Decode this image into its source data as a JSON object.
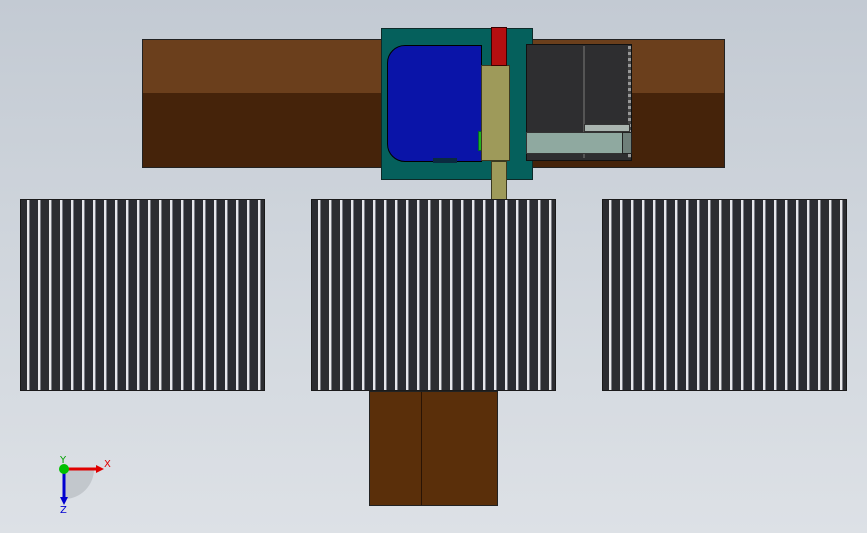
{
  "viewport": {
    "background": "#cfd5dc"
  },
  "colors": {
    "beam_top": "#6b3f1c",
    "beam_bottom": "#45230a",
    "housing": "#05605c",
    "drum": "#0a14a8",
    "olive": "#9e9a5a",
    "red": "#b40f10",
    "roller_dark": "#2c2d31",
    "conveyor": "#5a2f0a",
    "axis_x": "#e00000",
    "axis_y": "#00b000",
    "axis_z": "#0000d0"
  },
  "triad": {
    "x_label": "X",
    "y_label": "Y",
    "z_label": "Z"
  }
}
